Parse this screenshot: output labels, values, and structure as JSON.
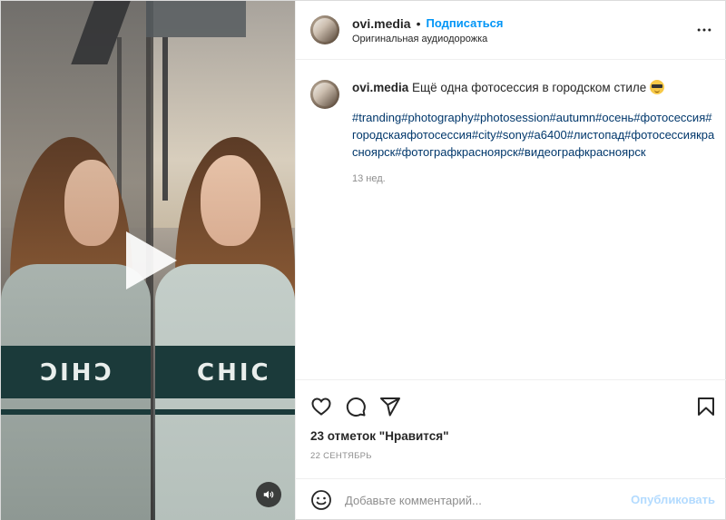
{
  "post": {
    "username": "ovi.media",
    "separator": "•",
    "follow_label": "Подписаться",
    "audio_label": "Оригинальная аудиодорожка",
    "caption_text": "Ещё одна фотосессия в городском стиле",
    "caption_emoji": "smiling-face-with-sunglasses",
    "hashtags": "#tranding#photography#photosession#autumn#осень#фотосессия#городскаяфотосессия#city#sony#a6400#листопад#фотосессиякрасноярск#фотографкрасноярск#видеографкрасноярск",
    "time_ago": "13 нед.",
    "likes_label": "23 отметок \"Нравится\"",
    "date_label": "22 СЕНТЯБРЬ"
  },
  "media": {
    "sweater_text": "CHIC",
    "sweater_text_mirrored": "CHIC"
  },
  "comment_box": {
    "placeholder": "Добавьте комментарий...",
    "publish_label": "Опубликовать"
  },
  "icons": {
    "more": "more-horizontal-icon",
    "like": "heart-icon",
    "comment": "comment-icon",
    "share": "send-icon",
    "save": "bookmark-icon",
    "emoji": "smiley-icon",
    "sound": "speaker-icon",
    "play": "play-icon"
  },
  "colors": {
    "link": "#0095f6",
    "hashtag": "#00376b",
    "publish_disabled": "#b3dbff",
    "muted": "#8e8e8e"
  }
}
